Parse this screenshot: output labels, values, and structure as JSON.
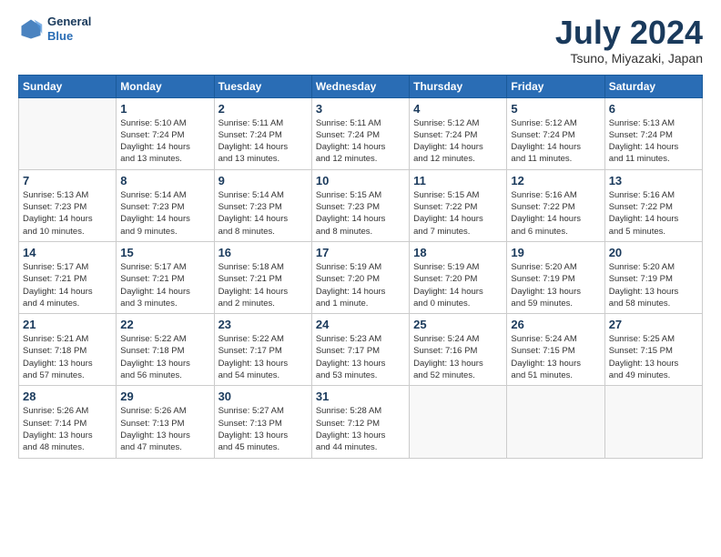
{
  "header": {
    "logo_line1": "General",
    "logo_line2": "Blue",
    "month_title": "July 2024",
    "location": "Tsuno, Miyazaki, Japan"
  },
  "days_of_week": [
    "Sunday",
    "Monday",
    "Tuesday",
    "Wednesday",
    "Thursday",
    "Friday",
    "Saturday"
  ],
  "weeks": [
    [
      {
        "day": "",
        "info": ""
      },
      {
        "day": "1",
        "info": "Sunrise: 5:10 AM\nSunset: 7:24 PM\nDaylight: 14 hours\nand 13 minutes."
      },
      {
        "day": "2",
        "info": "Sunrise: 5:11 AM\nSunset: 7:24 PM\nDaylight: 14 hours\nand 13 minutes."
      },
      {
        "day": "3",
        "info": "Sunrise: 5:11 AM\nSunset: 7:24 PM\nDaylight: 14 hours\nand 12 minutes."
      },
      {
        "day": "4",
        "info": "Sunrise: 5:12 AM\nSunset: 7:24 PM\nDaylight: 14 hours\nand 12 minutes."
      },
      {
        "day": "5",
        "info": "Sunrise: 5:12 AM\nSunset: 7:24 PM\nDaylight: 14 hours\nand 11 minutes."
      },
      {
        "day": "6",
        "info": "Sunrise: 5:13 AM\nSunset: 7:24 PM\nDaylight: 14 hours\nand 11 minutes."
      }
    ],
    [
      {
        "day": "7",
        "info": "Sunrise: 5:13 AM\nSunset: 7:23 PM\nDaylight: 14 hours\nand 10 minutes."
      },
      {
        "day": "8",
        "info": "Sunrise: 5:14 AM\nSunset: 7:23 PM\nDaylight: 14 hours\nand 9 minutes."
      },
      {
        "day": "9",
        "info": "Sunrise: 5:14 AM\nSunset: 7:23 PM\nDaylight: 14 hours\nand 8 minutes."
      },
      {
        "day": "10",
        "info": "Sunrise: 5:15 AM\nSunset: 7:23 PM\nDaylight: 14 hours\nand 8 minutes."
      },
      {
        "day": "11",
        "info": "Sunrise: 5:15 AM\nSunset: 7:22 PM\nDaylight: 14 hours\nand 7 minutes."
      },
      {
        "day": "12",
        "info": "Sunrise: 5:16 AM\nSunset: 7:22 PM\nDaylight: 14 hours\nand 6 minutes."
      },
      {
        "day": "13",
        "info": "Sunrise: 5:16 AM\nSunset: 7:22 PM\nDaylight: 14 hours\nand 5 minutes."
      }
    ],
    [
      {
        "day": "14",
        "info": "Sunrise: 5:17 AM\nSunset: 7:21 PM\nDaylight: 14 hours\nand 4 minutes."
      },
      {
        "day": "15",
        "info": "Sunrise: 5:17 AM\nSunset: 7:21 PM\nDaylight: 14 hours\nand 3 minutes."
      },
      {
        "day": "16",
        "info": "Sunrise: 5:18 AM\nSunset: 7:21 PM\nDaylight: 14 hours\nand 2 minutes."
      },
      {
        "day": "17",
        "info": "Sunrise: 5:19 AM\nSunset: 7:20 PM\nDaylight: 14 hours\nand 1 minute."
      },
      {
        "day": "18",
        "info": "Sunrise: 5:19 AM\nSunset: 7:20 PM\nDaylight: 14 hours\nand 0 minutes."
      },
      {
        "day": "19",
        "info": "Sunrise: 5:20 AM\nSunset: 7:19 PM\nDaylight: 13 hours\nand 59 minutes."
      },
      {
        "day": "20",
        "info": "Sunrise: 5:20 AM\nSunset: 7:19 PM\nDaylight: 13 hours\nand 58 minutes."
      }
    ],
    [
      {
        "day": "21",
        "info": "Sunrise: 5:21 AM\nSunset: 7:18 PM\nDaylight: 13 hours\nand 57 minutes."
      },
      {
        "day": "22",
        "info": "Sunrise: 5:22 AM\nSunset: 7:18 PM\nDaylight: 13 hours\nand 56 minutes."
      },
      {
        "day": "23",
        "info": "Sunrise: 5:22 AM\nSunset: 7:17 PM\nDaylight: 13 hours\nand 54 minutes."
      },
      {
        "day": "24",
        "info": "Sunrise: 5:23 AM\nSunset: 7:17 PM\nDaylight: 13 hours\nand 53 minutes."
      },
      {
        "day": "25",
        "info": "Sunrise: 5:24 AM\nSunset: 7:16 PM\nDaylight: 13 hours\nand 52 minutes."
      },
      {
        "day": "26",
        "info": "Sunrise: 5:24 AM\nSunset: 7:15 PM\nDaylight: 13 hours\nand 51 minutes."
      },
      {
        "day": "27",
        "info": "Sunrise: 5:25 AM\nSunset: 7:15 PM\nDaylight: 13 hours\nand 49 minutes."
      }
    ],
    [
      {
        "day": "28",
        "info": "Sunrise: 5:26 AM\nSunset: 7:14 PM\nDaylight: 13 hours\nand 48 minutes."
      },
      {
        "day": "29",
        "info": "Sunrise: 5:26 AM\nSunset: 7:13 PM\nDaylight: 13 hours\nand 47 minutes."
      },
      {
        "day": "30",
        "info": "Sunrise: 5:27 AM\nSunset: 7:13 PM\nDaylight: 13 hours\nand 45 minutes."
      },
      {
        "day": "31",
        "info": "Sunrise: 5:28 AM\nSunset: 7:12 PM\nDaylight: 13 hours\nand 44 minutes."
      },
      {
        "day": "",
        "info": ""
      },
      {
        "day": "",
        "info": ""
      },
      {
        "day": "",
        "info": ""
      }
    ]
  ]
}
